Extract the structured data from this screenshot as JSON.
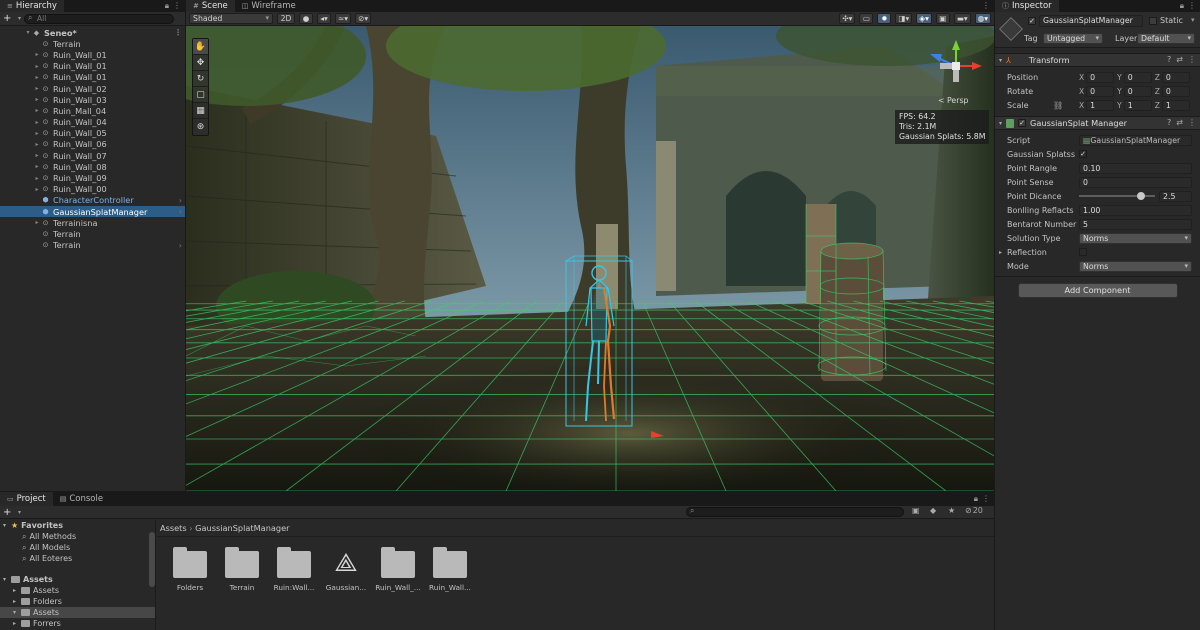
{
  "hierarchy": {
    "tab_label": "Hierarchy",
    "search_placeholder": "All",
    "scene_name": "Seneo*",
    "items": [
      {
        "label": "Terrain",
        "icon": "gameobject-icon"
      },
      {
        "label": "Ruin_Wall_01",
        "icon": "gameobject-icon"
      },
      {
        "label": "Ruin_Wall_01",
        "icon": "gameobject-icon"
      },
      {
        "label": "Ruin_Wall_01",
        "icon": "gameobject-icon"
      },
      {
        "label": "Ruin_Wall_02",
        "icon": "gameobject-icon"
      },
      {
        "label": "Ruin_Wall_03",
        "icon": "gameobject-icon"
      },
      {
        "label": "Ruin_Mall_04",
        "icon": "gameobject-icon"
      },
      {
        "label": "Ruin_Wall_04",
        "icon": "gameobject-icon"
      },
      {
        "label": "Ruin_Wall_05",
        "icon": "gameobject-icon"
      },
      {
        "label": "Ruin_Wall_06",
        "icon": "gameobject-icon"
      },
      {
        "label": "Ruin_Wall_07",
        "icon": "gameobject-icon"
      },
      {
        "label": "Ruin_Wall_08",
        "icon": "gameobject-icon"
      },
      {
        "label": "Ruin_Wall_09",
        "icon": "gameobject-icon"
      },
      {
        "label": "Ruin_Wall_00",
        "icon": "gameobject-icon"
      },
      {
        "label": "CharacterController",
        "icon": "prefab-icon"
      },
      {
        "label": "GaussianSplatManager",
        "icon": "prefab-icon"
      },
      {
        "label": "Terrainisna",
        "icon": "gameobject-icon"
      },
      {
        "label": "Terrain",
        "icon": "gameobject-icon"
      },
      {
        "label": "Terrain",
        "icon": "gameobject-icon"
      }
    ]
  },
  "scene": {
    "tabs": [
      "Scene",
      "Wireframe"
    ],
    "shading_mode": "Shaded",
    "toggle_2d": "2D",
    "stats": [
      "FPS: 64.2",
      "Tris: 2.1M",
      "Gaussian Splats: 5.8M"
    ],
    "persp_label": "< Persp"
  },
  "inspector": {
    "tab_label": "Inspector",
    "object_name": "GaussianSplatManager",
    "static_label": "Static",
    "tag_label": "Tag",
    "tag_value": "Untagged",
    "layer_label": "Layer",
    "layer_value": "Default",
    "transform": {
      "title": "Transform",
      "rows": [
        {
          "label": "Position",
          "x": "0",
          "y": "0",
          "z": "0"
        },
        {
          "label": "Rotate",
          "x": "0",
          "y": "0",
          "z": "0"
        },
        {
          "label": "Scale",
          "x": "1",
          "y": "1",
          "z": "1"
        }
      ]
    },
    "component": {
      "title": "GaussianSplat Manager",
      "script_label": "Script",
      "script_value": "GaussianSplatManager",
      "gaussian_splats_label": "Gaussian Splatss",
      "point_range_label": "Point Rangle",
      "point_range_value": "0.10",
      "point_sense_label": "Point Sense",
      "point_sense_value": "0",
      "point_distance_label": "Point Dicance",
      "point_distance_value": "2.5",
      "point_distance_fraction": 0.82,
      "bonding_label": "Bonlling Reflacts",
      "bonding_value": "1.00",
      "bentarot_label": "Bentarot Number",
      "bentarot_value": "5",
      "solution_label": "Solution Type",
      "solution_value": "Norms",
      "reflection_label": "Reflection",
      "mode_label": "Mode",
      "mode_value": "Norms"
    },
    "add_component_label": "Add Component"
  },
  "project": {
    "tabs": [
      "Project",
      "Console"
    ],
    "favorites_label": "Favorites",
    "favorites": [
      "All Methods",
      "All Models",
      "All Eoteres"
    ],
    "assets_label": "Assets",
    "assets_tree": [
      "Assets",
      "Folders",
      "Assets",
      "Forrers"
    ],
    "breadcrumb": [
      "Assets",
      "GaussianSplatManager"
    ],
    "hidden_count": "20",
    "grid": [
      {
        "label": "Folders",
        "icon": "folder-icon"
      },
      {
        "label": "Terrain",
        "icon": "folder-icon"
      },
      {
        "label": "Ruin:Wall...",
        "icon": "folder-icon"
      },
      {
        "label": "Gaussian...",
        "icon": "unity-logo-icon"
      },
      {
        "label": "Ruin_Wall_...",
        "icon": "folder-icon"
      },
      {
        "label": "Ruin_Wall...",
        "icon": "folder-icon"
      }
    ]
  },
  "colors": {
    "selection": "#2c5d87",
    "wireframe": "#3bd16b",
    "character": "#38c6e6",
    "gizmo_x": "#e8402e",
    "gizmo_y": "#7ad13a",
    "gizmo_z": "#3b82e8"
  }
}
